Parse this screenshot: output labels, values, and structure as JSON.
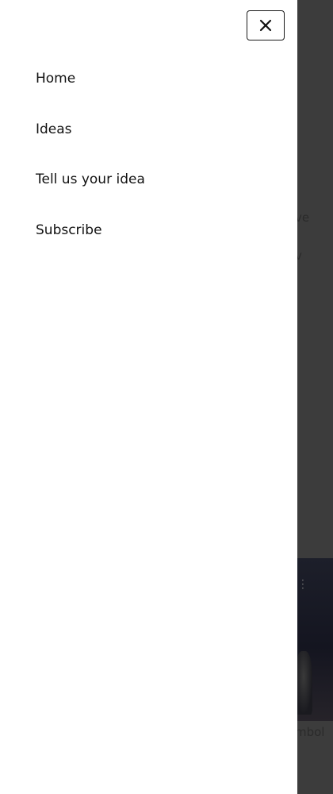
{
  "background": {
    "text_fragment_1": "ve",
    "text_fragment_2": "v",
    "text_fragment_3": "mbol"
  },
  "drawer": {
    "close_icon": "close-icon",
    "nav_items": [
      {
        "label": "Home"
      },
      {
        "label": "Ideas"
      },
      {
        "label": "Tell us your idea"
      },
      {
        "label": "Subscribe"
      }
    ]
  },
  "colors": {
    "overlay": "#3f3f3f",
    "drawer_bg": "#ffffff",
    "text": "#111111"
  }
}
